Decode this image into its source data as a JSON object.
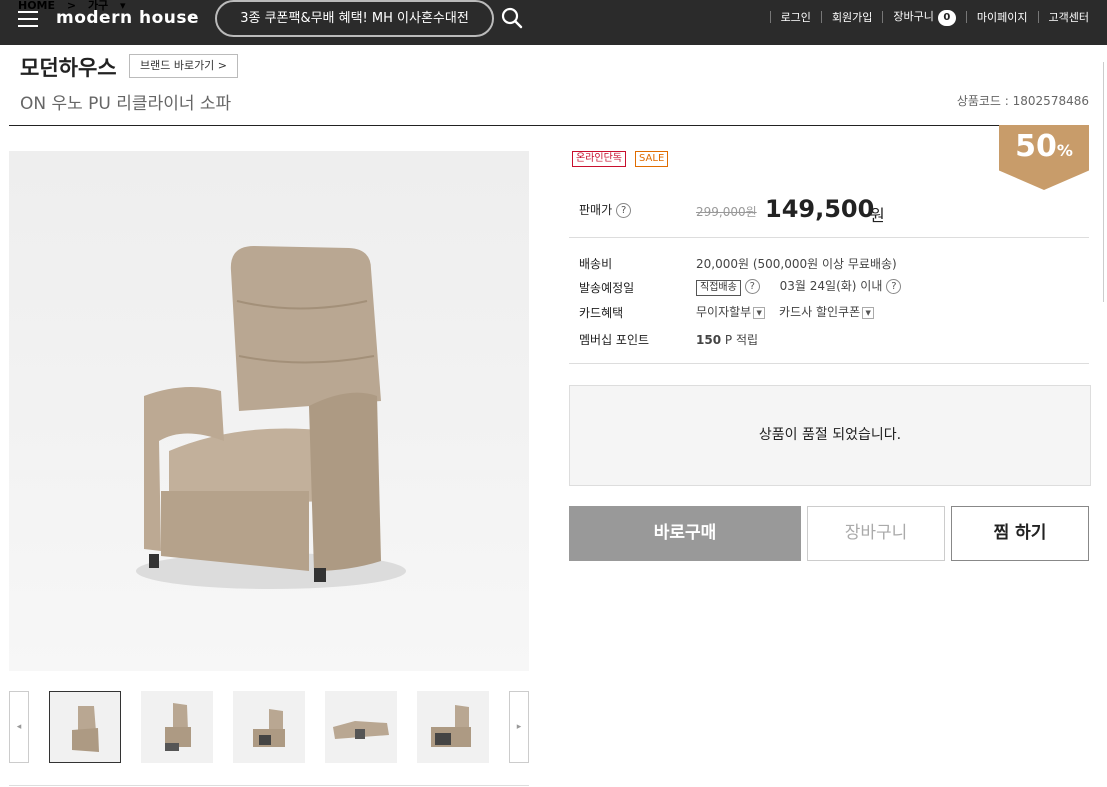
{
  "header": {
    "breadcrumb": [
      "HOME",
      ">",
      "가구",
      "▾"
    ],
    "logo": "modern house",
    "promo": "3종 쿠폰팩&무배 혜택! MH 이사혼수대전",
    "util": {
      "login": "로그인",
      "join": "회원가입",
      "cart": "장바구니",
      "cart_count": "0",
      "mypage": "마이페이지",
      "support": "고객센터"
    }
  },
  "product": {
    "brand": "모던하우스",
    "brand_button": "브랜드 바로가기 >",
    "name": "ON 우노 PU 리클라이너 소파",
    "code": "상품코드 : 1802578486",
    "badges": {
      "online": "온라인단독",
      "sale": "SALE"
    },
    "discount": {
      "value": "50",
      "unit": "%"
    },
    "price": {
      "label": "판매가",
      "original": "299,000원",
      "sale": "149,500",
      "unit": "원"
    },
    "shipping": {
      "label": "배송비",
      "value": "20,000원 (500,000원 이상 무료배송)"
    },
    "dispatch": {
      "label": "발송예정일",
      "tag": "직접배송",
      "value": "03월 24일(화) 이내"
    },
    "card": {
      "label": "카드혜택",
      "installment": "무이자할부",
      "coupon": "카드사 할인쿠폰"
    },
    "points": {
      "label": "멤버십 포인트",
      "value": "150",
      "unit": "P 적립"
    },
    "soldout": "상품이 품절 되었습니다.",
    "buttons": {
      "buy": "바로구매",
      "cart": "장바구니",
      "wish": "찜 하기"
    },
    "colors": {
      "accent": "#c89c6a",
      "sofa": "#b9a792"
    }
  },
  "gallery": {
    "prev": "◂",
    "next": "▸"
  }
}
